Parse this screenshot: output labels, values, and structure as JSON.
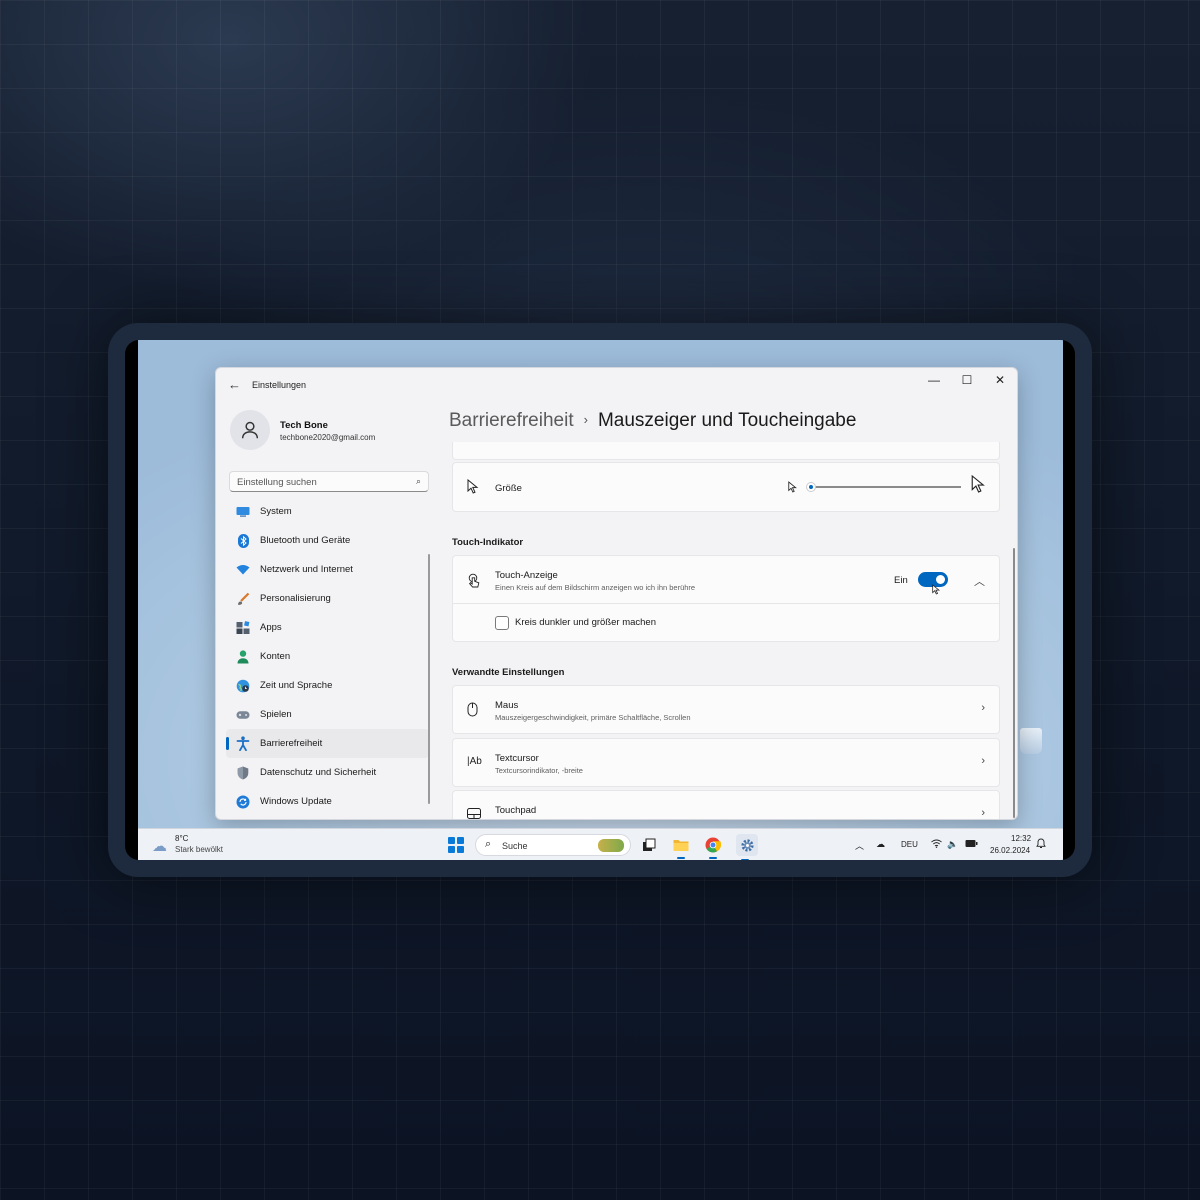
{
  "window": {
    "title": "Einstellungen",
    "controls": [
      "minimize-icon",
      "maximize-icon",
      "close-icon"
    ]
  },
  "user": {
    "name": "Tech Bone",
    "email": "techbone2020@gmail.com"
  },
  "search": {
    "placeholder": "Einstellung suchen"
  },
  "sidebar": {
    "items": [
      {
        "label": "System",
        "icon": "monitor-icon",
        "active": false
      },
      {
        "label": "Bluetooth und Geräte",
        "icon": "bluetooth-icon",
        "active": false
      },
      {
        "label": "Netzwerk und Internet",
        "icon": "wifi-icon",
        "active": false
      },
      {
        "label": "Personalisierung",
        "icon": "brush-icon",
        "active": false
      },
      {
        "label": "Apps",
        "icon": "apps-icon",
        "active": false
      },
      {
        "label": "Konten",
        "icon": "person-icon",
        "active": false
      },
      {
        "label": "Zeit und Sprache",
        "icon": "globe-clock-icon",
        "active": false
      },
      {
        "label": "Spielen",
        "icon": "gamepad-icon",
        "active": false
      },
      {
        "label": "Barrierefreiheit",
        "icon": "accessibility-icon",
        "active": true
      },
      {
        "label": "Datenschutz und Sicherheit",
        "icon": "shield-icon",
        "active": false
      },
      {
        "label": "Windows Update",
        "icon": "update-icon",
        "active": false
      }
    ]
  },
  "breadcrumb": {
    "parent": "Barrierefreiheit",
    "separator": "›",
    "current": "Mauszeiger und Toucheingabe"
  },
  "size_row": {
    "label": "Größe",
    "slider_value": 0
  },
  "touch_section": {
    "heading": "Touch-Indikator",
    "title": "Touch-Anzeige",
    "subtitle": "Einen Kreis auf dem Bildschirm anzeigen wo ich ihn berühre",
    "toggle_label": "Ein",
    "toggle_on": true,
    "checkbox_label": "Kreis dunkler und größer machen",
    "checkbox_checked": false
  },
  "related": {
    "heading": "Verwandte Einstellungen",
    "items": [
      {
        "title": "Maus",
        "subtitle": "Mauszeigergeschwindigkeit, primäre Schaltfläche, Scrollen",
        "icon": "mouse-icon"
      },
      {
        "title": "Textcursor",
        "subtitle": "Textcursorindikator, -breite",
        "icon": "text-cursor-icon",
        "icon_text": "|Ab"
      },
      {
        "title": "Touchpad",
        "subtitle": "",
        "icon": "touchpad-icon"
      }
    ]
  },
  "taskbar": {
    "weather_temp": "8°C",
    "weather_condition": "Stark bewölkt",
    "search_label": "Suche",
    "language": "DEU",
    "time": "12:32",
    "date": "26.02.2024"
  },
  "colors": {
    "accent": "#0067c0",
    "window_bg": "#f3f3f5"
  }
}
